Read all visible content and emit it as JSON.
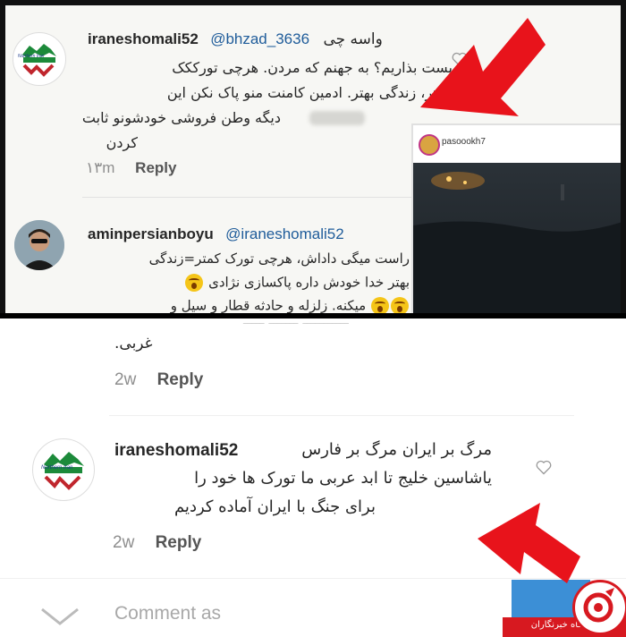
{
  "top_comment_1": {
    "username": "iraneshomali52",
    "mention": "@bhzad_3636",
    "first_word": "واسه چی",
    "lines": [
      "پست بذاریم؟ به جهنم که مردن. هرچی تورککک",
      "کمتر، زندگی بهتر. ادمین کامنت منو پاک نکن این",
      "دیگه وطن فروشی خودشونو ثابت",
      "کردن"
    ],
    "time": "۱۳m",
    "reply": "Reply",
    "avatar_text": "Northern Iran"
  },
  "inset": {
    "username": "pasoookh7"
  },
  "top_comment_2": {
    "username": "aminpersianboyu",
    "mention": "@iraneshomali52",
    "lines": [
      "راست میگی داداش، هرچی تورک کمتر=زندگی",
      "بهتر خدا خودش داره پاکسازی نژادی",
      "میکنه. زلزله و حادثه قطار و سیل و"
    ]
  },
  "bottom_partial": {
    "line": "غربی.",
    "time": "2w",
    "reply": "Reply"
  },
  "bottom_comment": {
    "username": "iraneshomali52",
    "lines": [
      "مرگ بر ایران مرگ بر فارس",
      "یاشاسین خلیج تا ابد عربی ما تورک ها خود را",
      "برای جنگ با ایران آماده کردیم"
    ],
    "time": "2w",
    "reply": "Reply",
    "avatar_text": "Northern Iran"
  },
  "comment_box": {
    "placeholder": "Comment as"
  },
  "watermark": {
    "text": "باشگاه خبرنگاران"
  },
  "colors": {
    "arrow": "#e8131b",
    "watermark_red": "#d71920",
    "inset_bg": "#1c2228"
  }
}
